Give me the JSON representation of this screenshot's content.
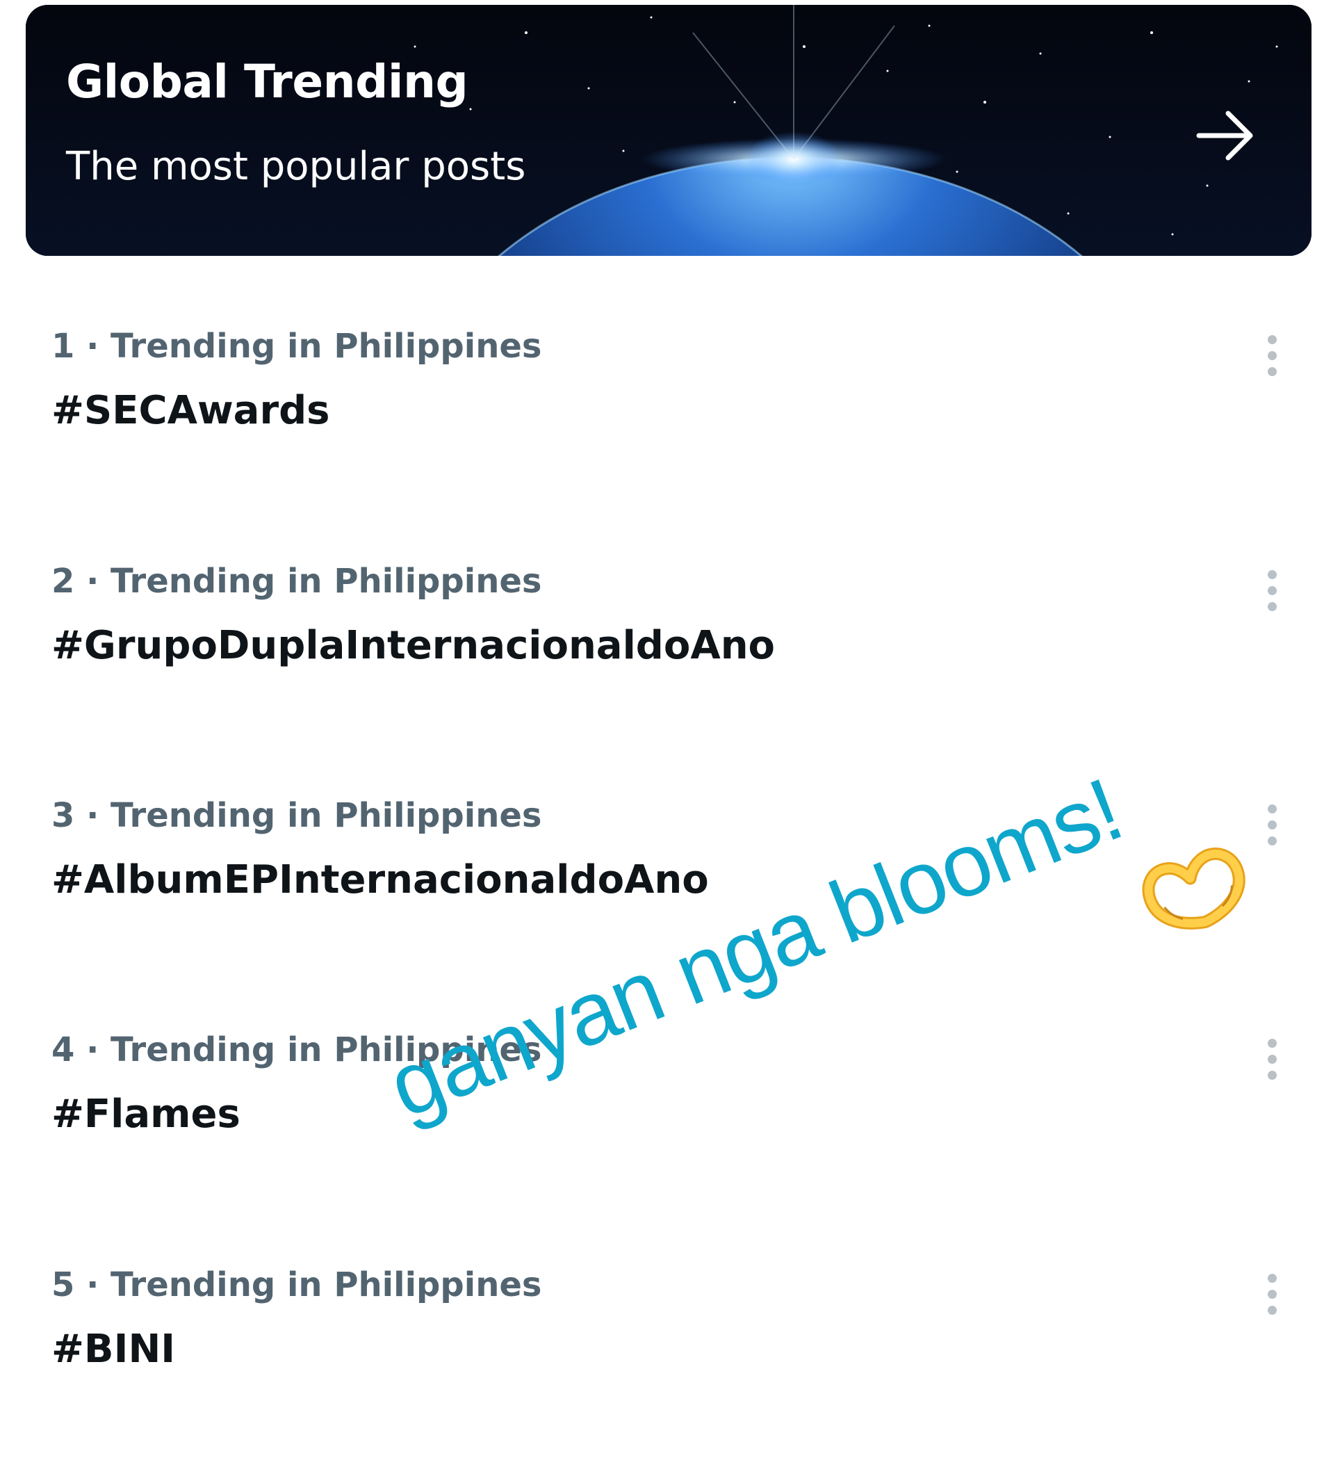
{
  "banner": {
    "title": "Global Trending",
    "subtitle": "The most popular posts",
    "arrow_icon": "arrow-right-icon"
  },
  "trends": [
    {
      "meta": "1 · Trending in Philippines",
      "name": "#SECAwards"
    },
    {
      "meta": "2 · Trending in Philippines",
      "name": "#GrupoDuplaInternacionaldoAno"
    },
    {
      "meta": "3 · Trending in Philippines",
      "name": "#AlbumEPInternacionaldoAno"
    },
    {
      "meta": "4 · Trending in Philippines",
      "name": "#Flames"
    },
    {
      "meta": "5 · Trending in Philippines",
      "name": "#BINI"
    }
  ],
  "more_icon": "more-vertical-icon",
  "overlay": {
    "caption": "ganyan nga blooms!",
    "emoji_icon": "heart-hands-emoji-icon"
  },
  "colors": {
    "meta_text": "#536471",
    "trend_text": "#0f1419",
    "caption": "#0fa6cc",
    "banner_bg": "#04060e"
  }
}
